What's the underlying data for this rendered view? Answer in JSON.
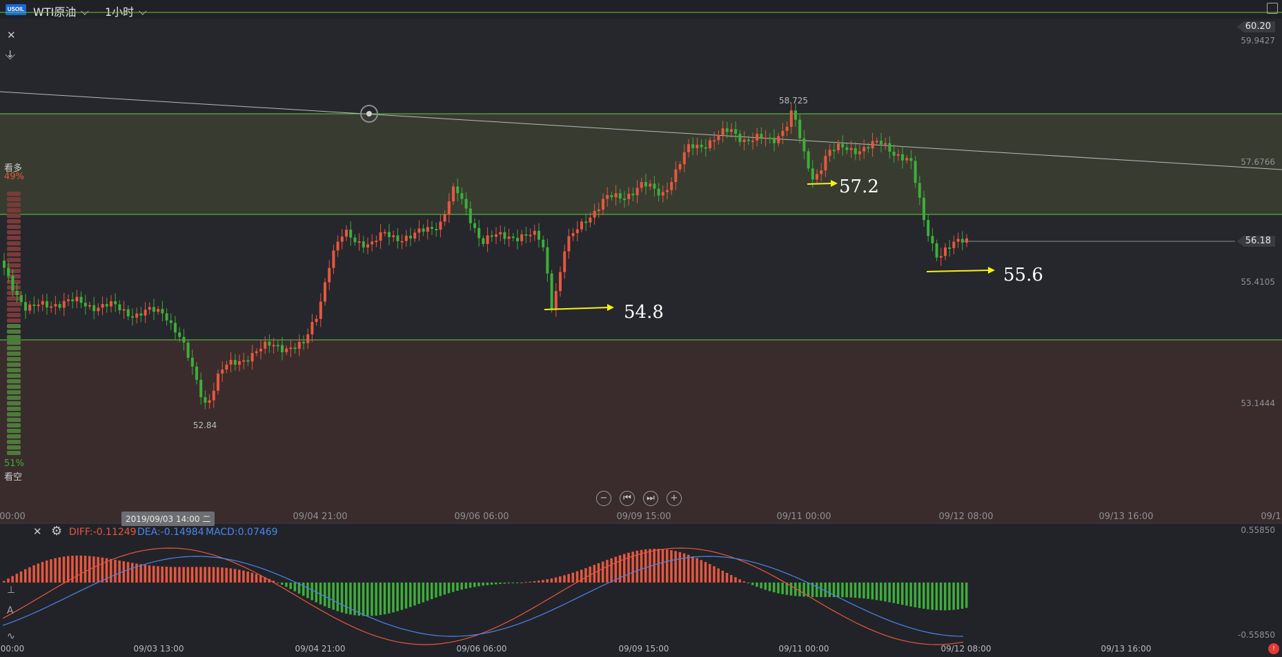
{
  "header": {
    "logo_text": "USOIL",
    "symbol": "WTI原油",
    "interval": "1小时"
  },
  "sentiment": {
    "bull_label": "看多",
    "bull_pct": "49%",
    "bear_label": "看空",
    "bear_pct": "51%",
    "bull_fraction": 0.49
  },
  "price_axis": {
    "top_label": "60.20",
    "levels": [
      "59.9427",
      "57.6766",
      "55.4105",
      "53.1444"
    ],
    "last_price": "56.18"
  },
  "chart_annotations": {
    "high": "58.725",
    "low": "52.84",
    "arrow_1": "54.8",
    "arrow_2": "57.2",
    "arrow_3": "55.6"
  },
  "x_axis": {
    "main": [
      "00:00",
      "09/04 21:00",
      "09/06 06:00",
      "09/09 15:00",
      "09/11 00:00",
      "09/12 08:00",
      "09/13 16:00",
      "09/1"
    ],
    "macd": [
      "00:00",
      "09/03 13:00",
      "09/04 21:00",
      "09/06 06:00",
      "09/09 15:00",
      "09/11 00:00",
      "09/12 08:00",
      "09/13 16:00"
    ]
  },
  "crosshair_date": "2019/09/03 14:00 二",
  "macd": {
    "diff": "DIFF:-0.11249",
    "dea": "DEA:-0.14984",
    "macd": "MACD:0.07469",
    "axis_top": "0.55850",
    "axis_bottom": "-0.55850"
  },
  "colors": {
    "up": "#e8573f",
    "down": "#3dae3a",
    "zone_upper": "#383c30",
    "zone_lower": "#3a2c2c",
    "diff_line": "#e8573f",
    "dea_line": "#4a86f0",
    "arrow": "#f7f21a",
    "hline": "#5fcf3f"
  },
  "icons": {
    "close": "close-icon",
    "collapse": "collapse-icon",
    "gear": "gear-icon",
    "zoom_out": "zoom-out-icon",
    "zoom_in": "zoom-in-icon",
    "step_back": "step-back-icon",
    "step_forward": "step-forward-icon"
  }
}
